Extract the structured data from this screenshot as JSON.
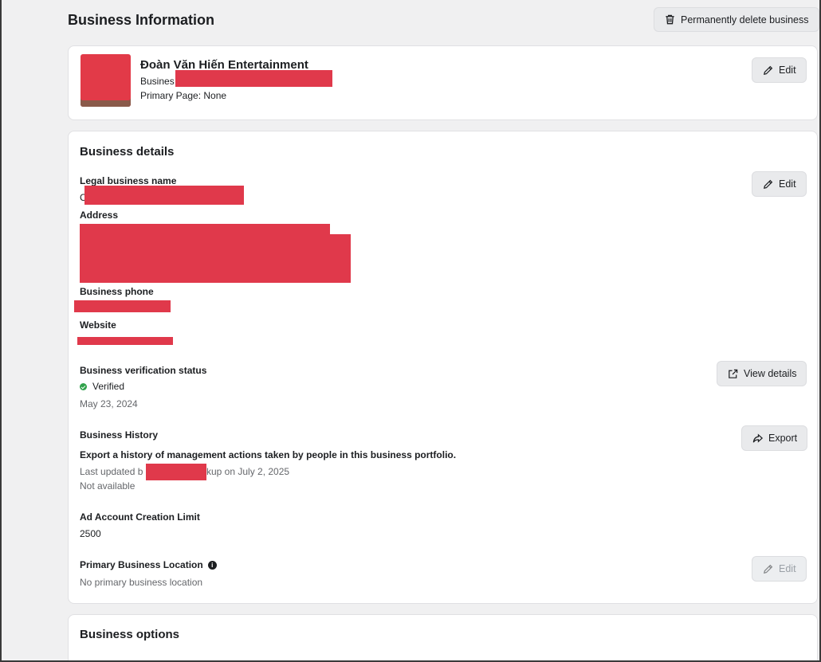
{
  "header": {
    "title": "Business Information",
    "delete_label": "Permanently delete business"
  },
  "profile": {
    "name": "Đoàn Văn Hiến Entertainment",
    "id_prefix": "Busines",
    "primary_page": "Primary Page: None",
    "edit_label": "Edit"
  },
  "details": {
    "title": "Business details",
    "edit_label": "Edit",
    "legal_name_label": "Legal business name",
    "legal_name_prefix": "C",
    "address_label": "Address",
    "phone_label": "Business phone",
    "website_label": "Website",
    "verification": {
      "label": "Business verification status",
      "status": "Verified",
      "date": "May 23, 2024",
      "button_label": "View details"
    },
    "history": {
      "label": "Business History",
      "description": "Export a history of management actions taken by people in this business portfolio.",
      "updated_prefix": "Last updated b",
      "updated_suffix": "kup on July 2, 2025",
      "availability": "Not available",
      "button_label": "Export"
    },
    "ad_limit": {
      "label": "Ad Account Creation Limit",
      "value": "2500"
    },
    "location": {
      "label": "Primary Business Location",
      "value": "No primary business location",
      "edit_label": "Edit"
    }
  },
  "options": {
    "title": "Business options"
  },
  "colors": {
    "redaction": "#e0394b",
    "verified": "#31a24c",
    "page_bg": "#f0f0f1"
  }
}
